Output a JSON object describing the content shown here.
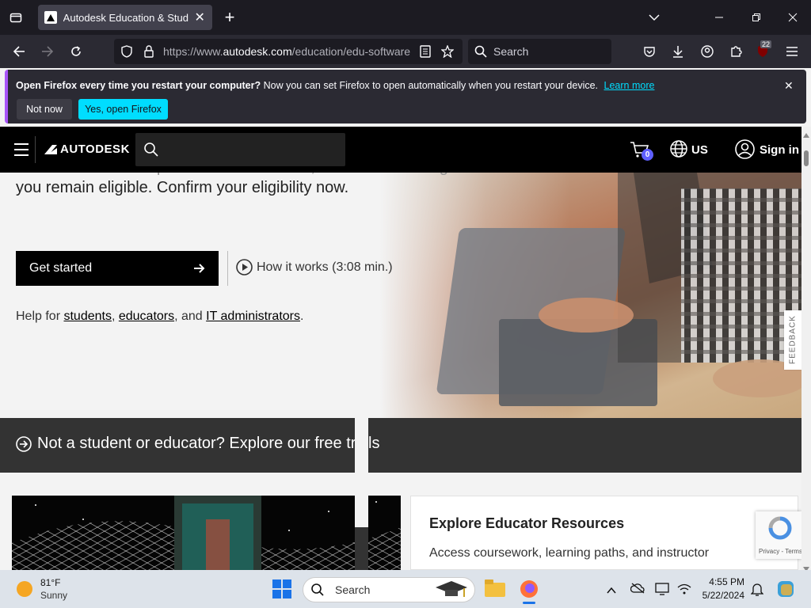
{
  "browser": {
    "tab_title": "Autodesk Education & Student",
    "tab_close": "✕",
    "new_tab": "+",
    "url_prefix": "https://www.",
    "url_domain": "autodesk.com",
    "url_path": "/education/edu-software",
    "search_placeholder": "Search",
    "extension_badge": "22"
  },
  "notification": {
    "bold_text": "Open Firefox every time you restart your computer?",
    "text": " Now you can set Firefox to open automatically when you restart your device.",
    "link": "Learn more",
    "not_now": "Not now",
    "yes": "Yes, open Firefox"
  },
  "autodesk": {
    "logo": "AUTODESK",
    "cart_count": "0",
    "region": "US",
    "sign_in": "Sign in"
  },
  "hero": {
    "line1": "access to Autodesk products and services, renewable as long as",
    "line2": "you remain eligible. Confirm your eligibility now.",
    "cta": "Get started",
    "how_it_works": "How it works (3:08 min.)",
    "help_prefix": "Help for ",
    "help_students": "students",
    "help_sep1": ", ",
    "help_educators": "educators",
    "help_sep2": ", and ",
    "help_it": "IT administrators",
    "help_suffix": "."
  },
  "trial": {
    "text": "Not a student or educator? Explore our free trials"
  },
  "card": {
    "title": "Explore Educator Resources",
    "body": "Access coursework, learning paths, and instructor"
  },
  "feedback": "FEEDBACK",
  "recaptcha": "Privacy - Terms",
  "taskbar": {
    "temp": "81°F",
    "condition": "Sunny",
    "search": "Search",
    "time": "4:55 PM",
    "date": "5/22/2024"
  },
  "colors": {
    "firefox_dark": "#1c1b22",
    "firefox_accent": "#00ddff",
    "autodesk_black": "#000000",
    "cart_badge": "#5f60ff"
  }
}
